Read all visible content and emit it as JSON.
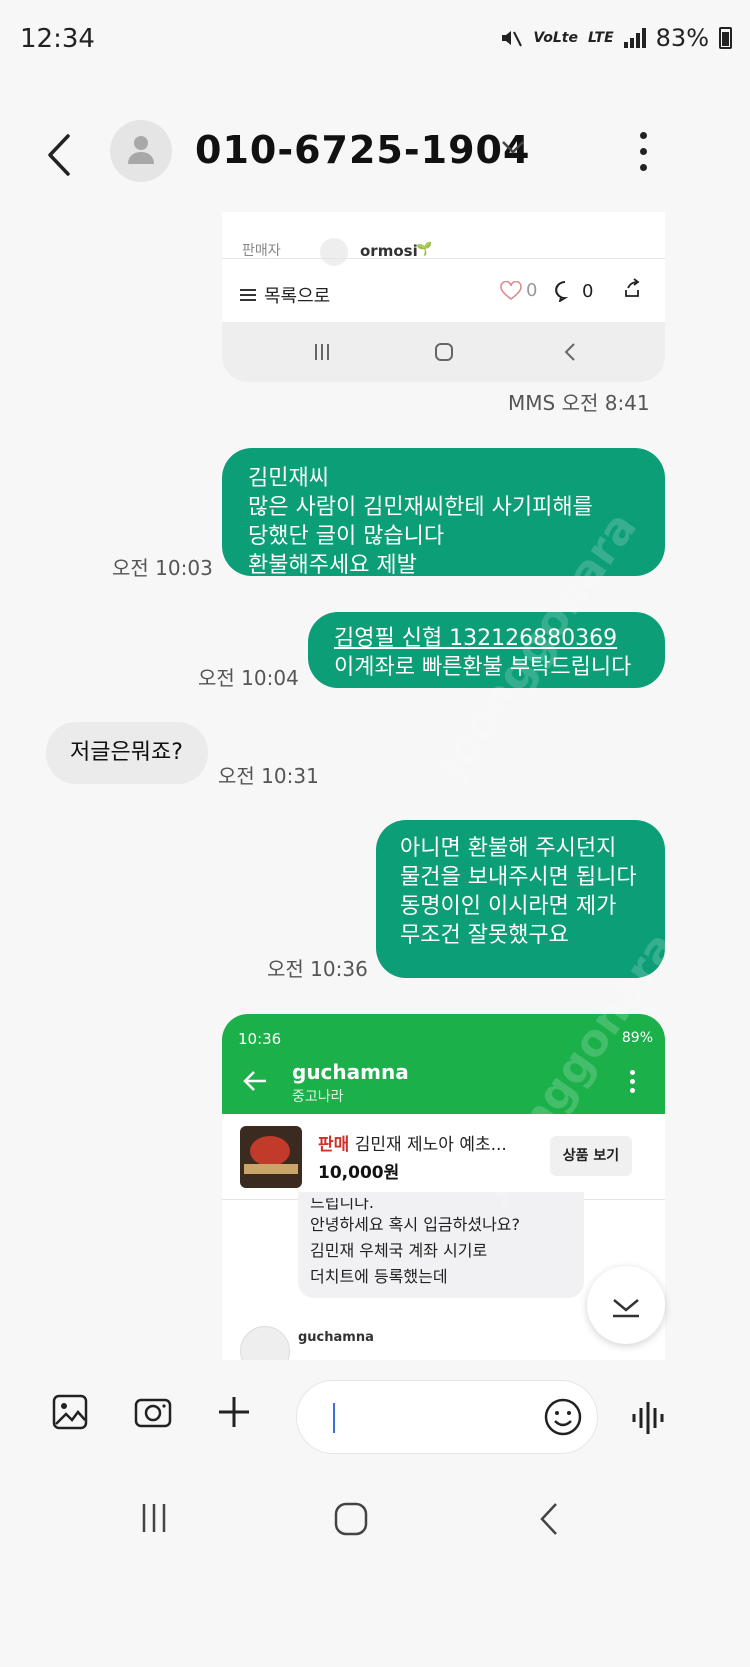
{
  "status_bar": {
    "time": "12:34",
    "volte": "VoLte",
    "lte": "LTE",
    "battery": "83%"
  },
  "header": {
    "phone_number": "010-6725-1904"
  },
  "embedded_top": {
    "seller_label": "판매자",
    "seller_name": "ormosi",
    "list_label": "목록으로",
    "likes": "0",
    "comments": "0"
  },
  "messages": [
    {
      "direction": "incoming",
      "type": "mms",
      "timestamp": "MMS 오전 8:41"
    },
    {
      "direction": "outgoing",
      "lines": [
        "김민재씨",
        "많은 사람이 김민재씨한테 사기피해를",
        "당했단 글이 많습니다",
        "환불해주세요 제발"
      ],
      "timestamp": "오전 10:03"
    },
    {
      "direction": "outgoing",
      "lines": [
        "김영필   신협 132126880369",
        "이계좌로 빠른환불 부탁드립니다"
      ],
      "timestamp": "오전 10:04"
    },
    {
      "direction": "incoming",
      "lines": [
        "저글은뭐죠?"
      ],
      "timestamp": "오전 10:31"
    },
    {
      "direction": "outgoing",
      "lines": [
        "아니면 환불해 주시던지",
        "물건을 보내주시면 됩니다",
        "동명이인 이시라면 제가",
        "무조건 잘못했구요"
      ],
      "timestamp": "오전 10:36"
    }
  ],
  "embedded_bottom": {
    "time": "10:36",
    "battery": "89%",
    "chat_name": "guchamna",
    "app_name": "중고나라",
    "product_tag": "판매",
    "product_title": "김민재 제노아 예초...",
    "price": "10,000원",
    "product_button": "상품 보기",
    "message_lines": [
      "드립니다.",
      "안녕하세요 혹시 입금하셨나요?",
      "김민재 우체국 계좌  시기로",
      "더치트에 등록했는데"
    ],
    "second_sender": "guchamna"
  },
  "watermark_text": "joonggonara",
  "colors": {
    "outgoing_bubble": "#0c9e77",
    "incoming_bubble": "#ebebeb",
    "embedded_header": "#1bb04a"
  }
}
